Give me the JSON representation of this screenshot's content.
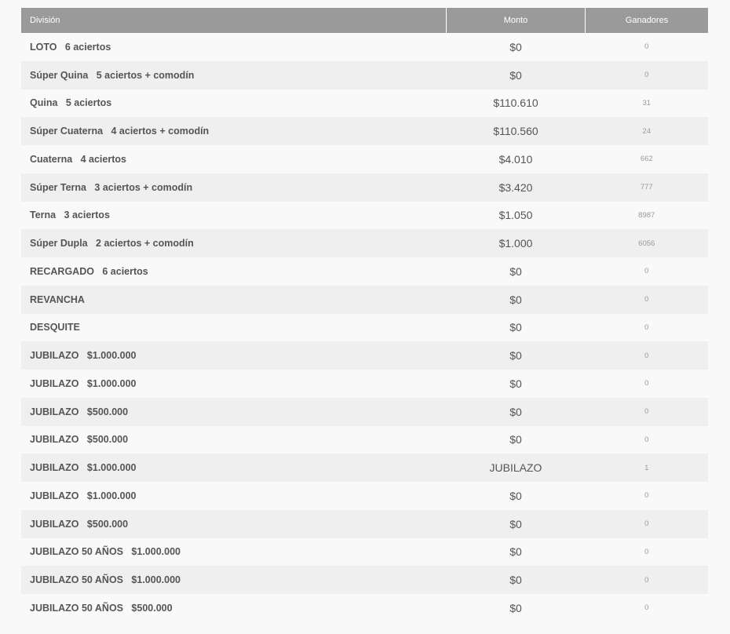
{
  "table": {
    "headers": {
      "division": "División",
      "monto": "Monto",
      "ganadores": "Ganadores"
    },
    "rows": [
      {
        "division": "LOTO   6 aciertos",
        "monto": "$0",
        "ganadores": "0"
      },
      {
        "division": "Súper Quina   5 aciertos + comodín",
        "monto": "$0",
        "ganadores": "0"
      },
      {
        "division": "Quina   5 aciertos",
        "monto": "$110.610",
        "ganadores": "31"
      },
      {
        "division": "Súper Cuaterna   4 aciertos + comodín",
        "monto": "$110.560",
        "ganadores": "24"
      },
      {
        "division": "Cuaterna   4 aciertos",
        "monto": "$4.010",
        "ganadores": "662"
      },
      {
        "division": "Súper Terna   3 aciertos + comodín",
        "monto": "$3.420",
        "ganadores": "777"
      },
      {
        "division": "Terna   3 aciertos",
        "monto": "$1.050",
        "ganadores": "8987"
      },
      {
        "division": "Súper Dupla   2 aciertos + comodín",
        "monto": "$1.000",
        "ganadores": "6056"
      },
      {
        "division": "RECARGADO   6 aciertos",
        "monto": "$0",
        "ganadores": "0"
      },
      {
        "division": "REVANCHA",
        "monto": "$0",
        "ganadores": "0"
      },
      {
        "division": "DESQUITE",
        "monto": "$0",
        "ganadores": "0"
      },
      {
        "division": "JUBILAZO   $1.000.000",
        "monto": "$0",
        "ganadores": "0"
      },
      {
        "division": "JUBILAZO   $1.000.000",
        "monto": "$0",
        "ganadores": "0"
      },
      {
        "division": "JUBILAZO   $500.000",
        "monto": "$0",
        "ganadores": "0"
      },
      {
        "division": "JUBILAZO   $500.000",
        "monto": "$0",
        "ganadores": "0"
      },
      {
        "division": "JUBILAZO   $1.000.000",
        "monto": "JUBILAZO",
        "ganadores": "1"
      },
      {
        "division": "JUBILAZO   $1.000.000",
        "monto": "$0",
        "ganadores": "0"
      },
      {
        "division": "JUBILAZO   $500.000",
        "monto": "$0",
        "ganadores": "0"
      },
      {
        "division": "JUBILAZO 50 AÑOS   $1.000.000",
        "monto": "$0",
        "ganadores": "0"
      },
      {
        "division": "JUBILAZO 50 AÑOS   $1.000.000",
        "monto": "$0",
        "ganadores": "0"
      },
      {
        "division": "JUBILAZO 50 AÑOS   $500.000",
        "monto": "$0",
        "ganadores": "0"
      }
    ]
  }
}
